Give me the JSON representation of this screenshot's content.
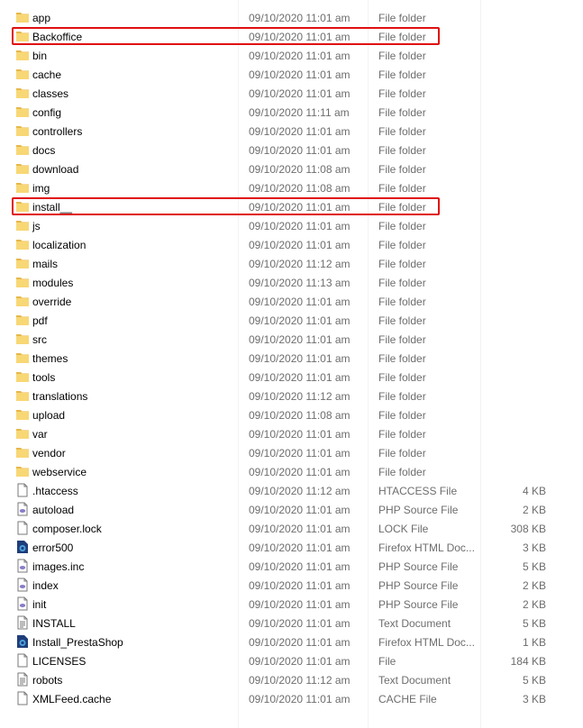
{
  "files": [
    {
      "name": "app",
      "date": "09/10/2020 11:01 am",
      "type": "File folder",
      "size": "",
      "icon": "folder-icon"
    },
    {
      "name": "Backoffice",
      "date": "09/10/2020 11:01 am",
      "type": "File folder",
      "size": "",
      "icon": "folder-icon",
      "highlighted": true
    },
    {
      "name": "bin",
      "date": "09/10/2020 11:01 am",
      "type": "File folder",
      "size": "",
      "icon": "folder-icon"
    },
    {
      "name": "cache",
      "date": "09/10/2020 11:01 am",
      "type": "File folder",
      "size": "",
      "icon": "folder-icon"
    },
    {
      "name": "classes",
      "date": "09/10/2020 11:01 am",
      "type": "File folder",
      "size": "",
      "icon": "folder-icon"
    },
    {
      "name": "config",
      "date": "09/10/2020 11:11 am",
      "type": "File folder",
      "size": "",
      "icon": "folder-icon"
    },
    {
      "name": "controllers",
      "date": "09/10/2020 11:01 am",
      "type": "File folder",
      "size": "",
      "icon": "folder-icon"
    },
    {
      "name": "docs",
      "date": "09/10/2020 11:01 am",
      "type": "File folder",
      "size": "",
      "icon": "folder-icon"
    },
    {
      "name": "download",
      "date": "09/10/2020 11:08 am",
      "type": "File folder",
      "size": "",
      "icon": "folder-icon"
    },
    {
      "name": "img",
      "date": "09/10/2020 11:08 am",
      "type": "File folder",
      "size": "",
      "icon": "folder-icon"
    },
    {
      "name": "install__",
      "date": "09/10/2020 11:01 am",
      "type": "File folder",
      "size": "",
      "icon": "folder-icon",
      "highlighted": true
    },
    {
      "name": "js",
      "date": "09/10/2020 11:01 am",
      "type": "File folder",
      "size": "",
      "icon": "folder-icon"
    },
    {
      "name": "localization",
      "date": "09/10/2020 11:01 am",
      "type": "File folder",
      "size": "",
      "icon": "folder-icon"
    },
    {
      "name": "mails",
      "date": "09/10/2020 11:12 am",
      "type": "File folder",
      "size": "",
      "icon": "folder-icon"
    },
    {
      "name": "modules",
      "date": "09/10/2020 11:13 am",
      "type": "File folder",
      "size": "",
      "icon": "folder-icon"
    },
    {
      "name": "override",
      "date": "09/10/2020 11:01 am",
      "type": "File folder",
      "size": "",
      "icon": "folder-icon"
    },
    {
      "name": "pdf",
      "date": "09/10/2020 11:01 am",
      "type": "File folder",
      "size": "",
      "icon": "folder-icon"
    },
    {
      "name": "src",
      "date": "09/10/2020 11:01 am",
      "type": "File folder",
      "size": "",
      "icon": "folder-icon"
    },
    {
      "name": "themes",
      "date": "09/10/2020 11:01 am",
      "type": "File folder",
      "size": "",
      "icon": "folder-icon"
    },
    {
      "name": "tools",
      "date": "09/10/2020 11:01 am",
      "type": "File folder",
      "size": "",
      "icon": "folder-icon"
    },
    {
      "name": "translations",
      "date": "09/10/2020 11:12 am",
      "type": "File folder",
      "size": "",
      "icon": "folder-icon"
    },
    {
      "name": "upload",
      "date": "09/10/2020 11:08 am",
      "type": "File folder",
      "size": "",
      "icon": "folder-icon"
    },
    {
      "name": "var",
      "date": "09/10/2020 11:01 am",
      "type": "File folder",
      "size": "",
      "icon": "folder-icon"
    },
    {
      "name": "vendor",
      "date": "09/10/2020 11:01 am",
      "type": "File folder",
      "size": "",
      "icon": "folder-icon"
    },
    {
      "name": "webservice",
      "date": "09/10/2020 11:01 am",
      "type": "File folder",
      "size": "",
      "icon": "folder-icon"
    },
    {
      "name": ".htaccess",
      "date": "09/10/2020 11:12 am",
      "type": "HTACCESS File",
      "size": "4 KB",
      "icon": "generic-file-icon"
    },
    {
      "name": "autoload",
      "date": "09/10/2020 11:01 am",
      "type": "PHP Source File",
      "size": "2 KB",
      "icon": "php-file-icon"
    },
    {
      "name": "composer.lock",
      "date": "09/10/2020 11:01 am",
      "type": "LOCK File",
      "size": "308 KB",
      "icon": "generic-file-icon"
    },
    {
      "name": "error500",
      "date": "09/10/2020 11:01 am",
      "type": "Firefox HTML Doc...",
      "size": "3 KB",
      "icon": "firefox-html-icon"
    },
    {
      "name": "images.inc",
      "date": "09/10/2020 11:01 am",
      "type": "PHP Source File",
      "size": "5 KB",
      "icon": "php-file-icon"
    },
    {
      "name": "index",
      "date": "09/10/2020 11:01 am",
      "type": "PHP Source File",
      "size": "2 KB",
      "icon": "php-file-icon"
    },
    {
      "name": "init",
      "date": "09/10/2020 11:01 am",
      "type": "PHP Source File",
      "size": "2 KB",
      "icon": "php-file-icon"
    },
    {
      "name": "INSTALL",
      "date": "09/10/2020 11:01 am",
      "type": "Text Document",
      "size": "5 KB",
      "icon": "text-document-icon"
    },
    {
      "name": "Install_PrestaShop",
      "date": "09/10/2020 11:01 am",
      "type": "Firefox HTML Doc...",
      "size": "1 KB",
      "icon": "firefox-html-icon"
    },
    {
      "name": "LICENSES",
      "date": "09/10/2020 11:01 am",
      "type": "File",
      "size": "184 KB",
      "icon": "generic-file-icon"
    },
    {
      "name": "robots",
      "date": "09/10/2020 11:12 am",
      "type": "Text Document",
      "size": "5 KB",
      "icon": "text-document-icon"
    },
    {
      "name": "XMLFeed.cache",
      "date": "09/10/2020 11:01 am",
      "type": "CACHE File",
      "size": "3 KB",
      "icon": "generic-file-icon"
    }
  ],
  "colors": {
    "folder": "#f8d775",
    "folder_dark": "#e6b84a",
    "highlight_border": "#e01010",
    "php_accent": "#8a7cc8",
    "firefox_dark": "#1f3d7a",
    "firefox_accent": "#4aa3df"
  }
}
